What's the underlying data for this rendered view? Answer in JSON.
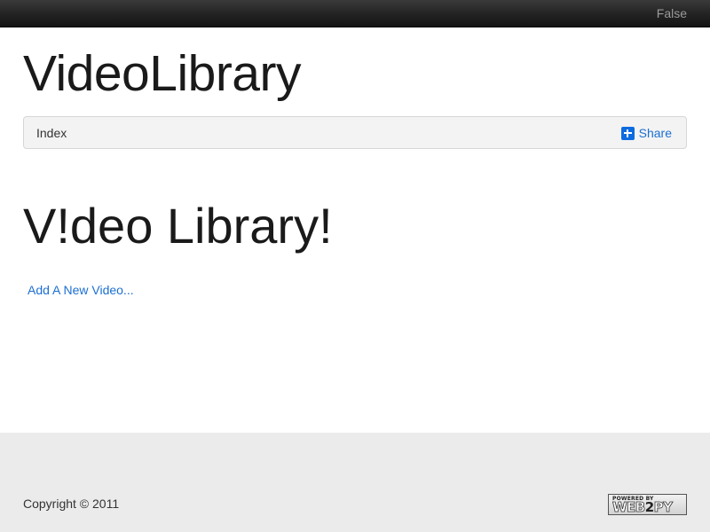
{
  "topbar": {
    "auth_label": "False"
  },
  "header": {
    "app_title": "VideoLibrary"
  },
  "navbar": {
    "items": [
      {
        "label": "Index"
      }
    ],
    "share_label": "Share",
    "share_icon": "plus-square-icon"
  },
  "main": {
    "heading": "V!deo Library!",
    "add_link_label": "Add A New Video..."
  },
  "footer": {
    "copyright": "Copyright © 2011",
    "badge": {
      "line1": "POWERED BY",
      "line2_a": "WEB",
      "line2_b": "2",
      "line2_c": "PY"
    }
  },
  "colors": {
    "link": "#1c6fd1",
    "share_icon_bg": "#0d6be0",
    "topbar": "#222222",
    "footer_bg": "#ebebeb"
  }
}
